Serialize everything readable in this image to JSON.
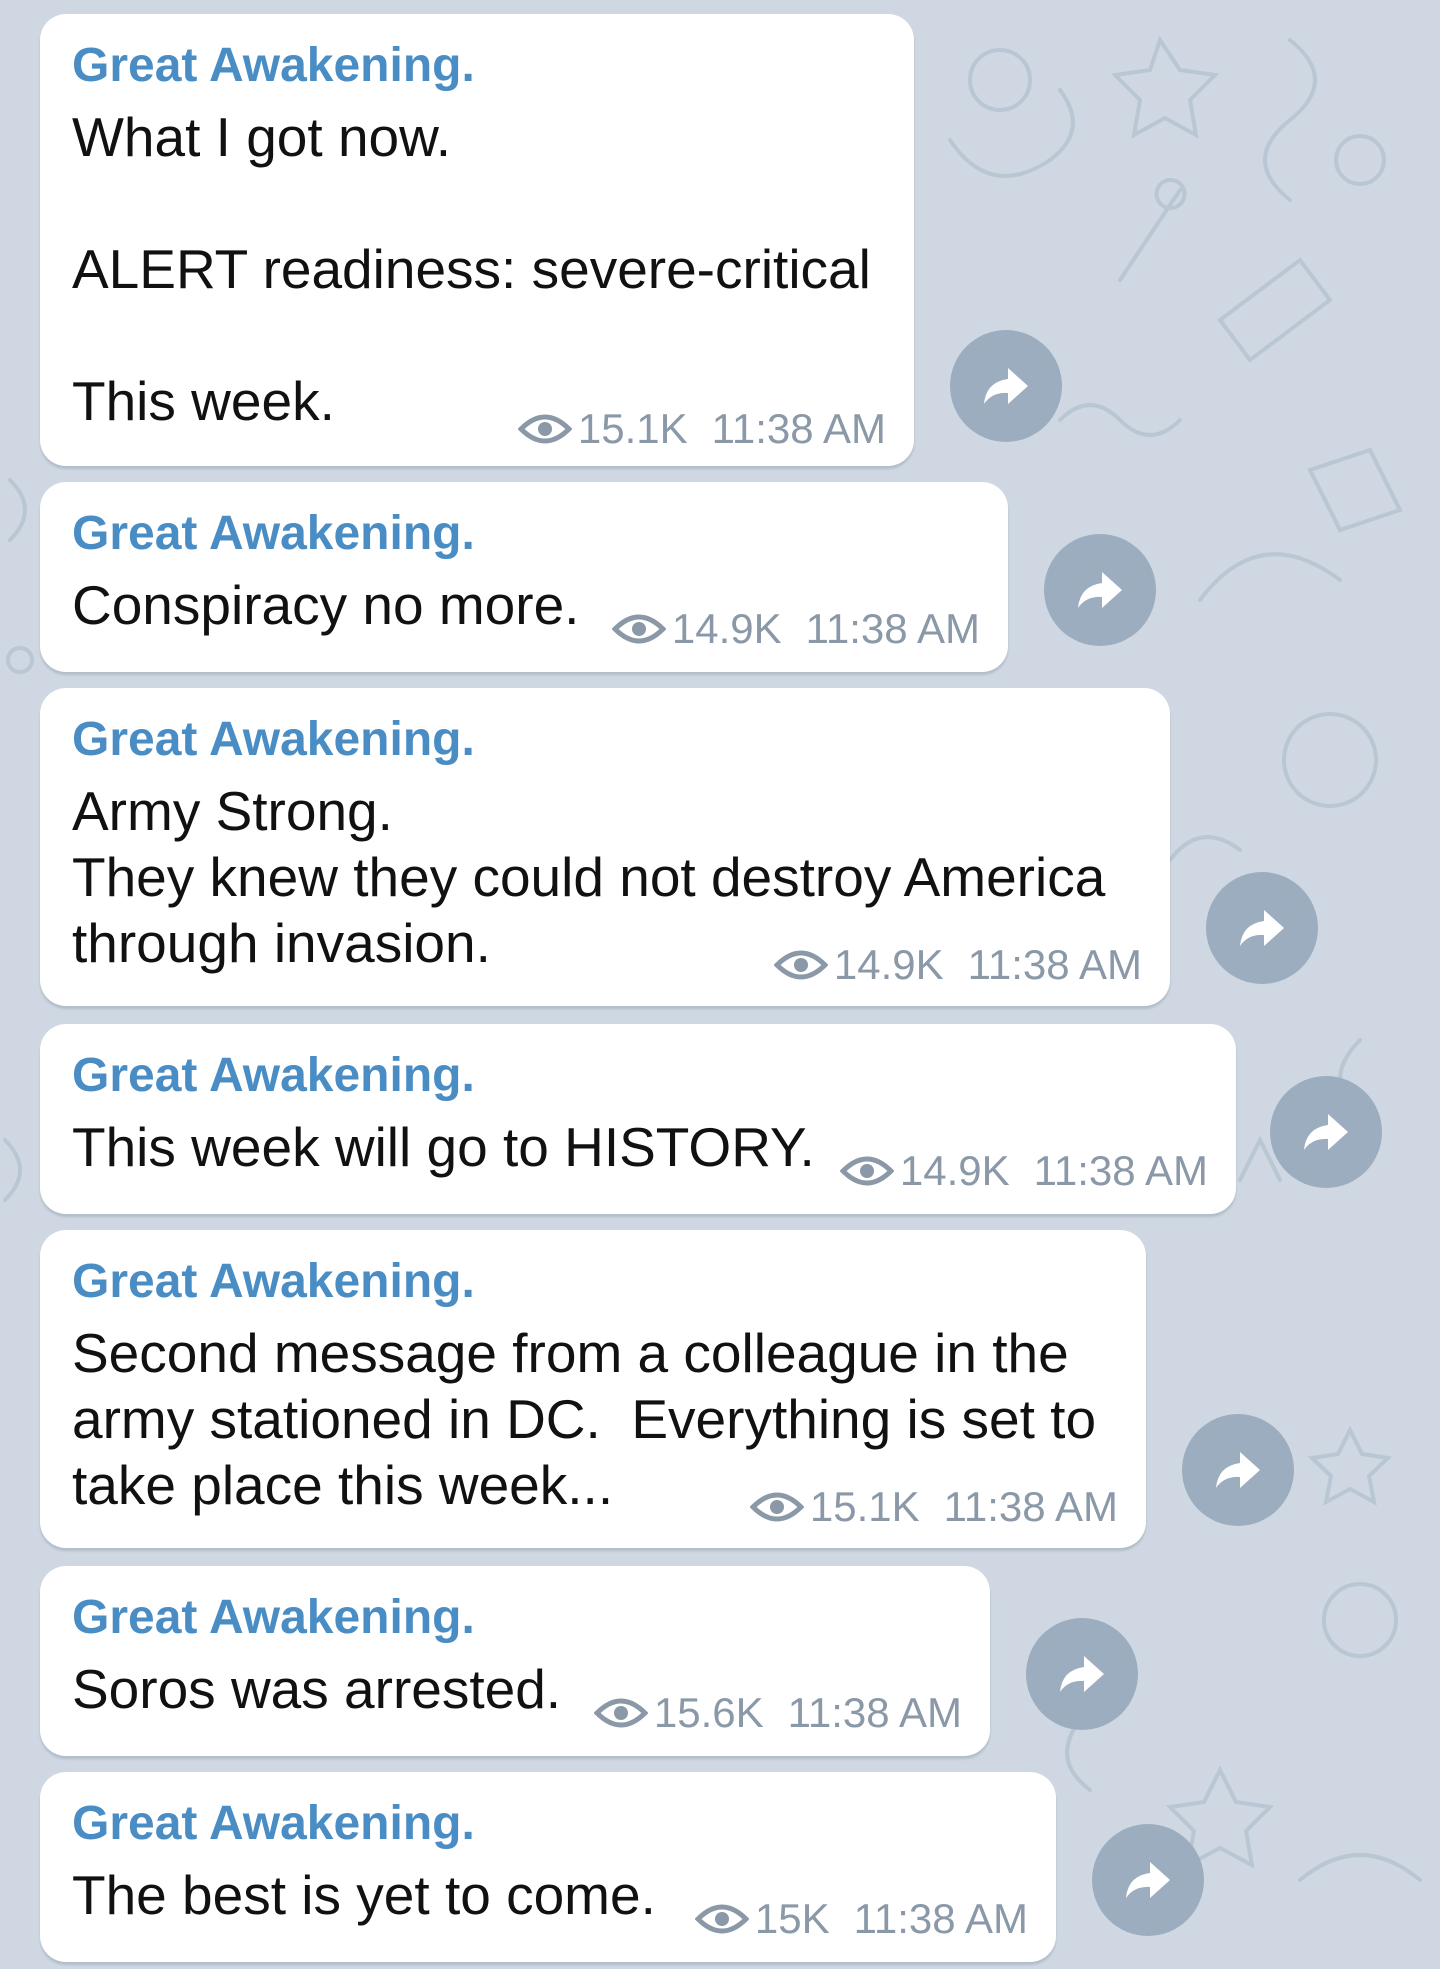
{
  "messages": [
    {
      "sender": "Great Awakening.",
      "text": "What I got now.\n\nALERT readiness: severe-critical\n\nThis week.",
      "views": "15.1K",
      "time": "11:38 AM"
    },
    {
      "sender": "Great Awakening.",
      "text": "Conspiracy no more.",
      "views": "14.9K",
      "time": "11:38 AM"
    },
    {
      "sender": "Great Awakening.",
      "text": "Army Strong.\nThey knew they could not destroy America\nthrough invasion.",
      "views": "14.9K",
      "time": "11:38 AM"
    },
    {
      "sender": "Great Awakening.",
      "text": "This week will go to HISTORY.",
      "views": "14.9K",
      "time": "11:38 AM"
    },
    {
      "sender": "Great Awakening.",
      "text": "Second message from a colleague in the\narmy stationed in DC.  Everything is set to\ntake place this week...",
      "views": "15.1K",
      "time": "11:38 AM"
    },
    {
      "sender": "Great Awakening.",
      "text": "Soros was arrested.",
      "views": "15.6K",
      "time": "11:38 AM"
    },
    {
      "sender": "Great Awakening.",
      "text": "The best is yet to come.",
      "views": "15K",
      "time": "11:38 AM"
    }
  ],
  "icons": {
    "views": "eye-icon",
    "share": "share-arrow-icon"
  },
  "colors": {
    "chat_background": "#cfd8e2",
    "bubble": "#ffffff",
    "sender_name": "#4a8dc4",
    "meta_text": "#8a98a7",
    "share_button": "#9cadbf"
  }
}
